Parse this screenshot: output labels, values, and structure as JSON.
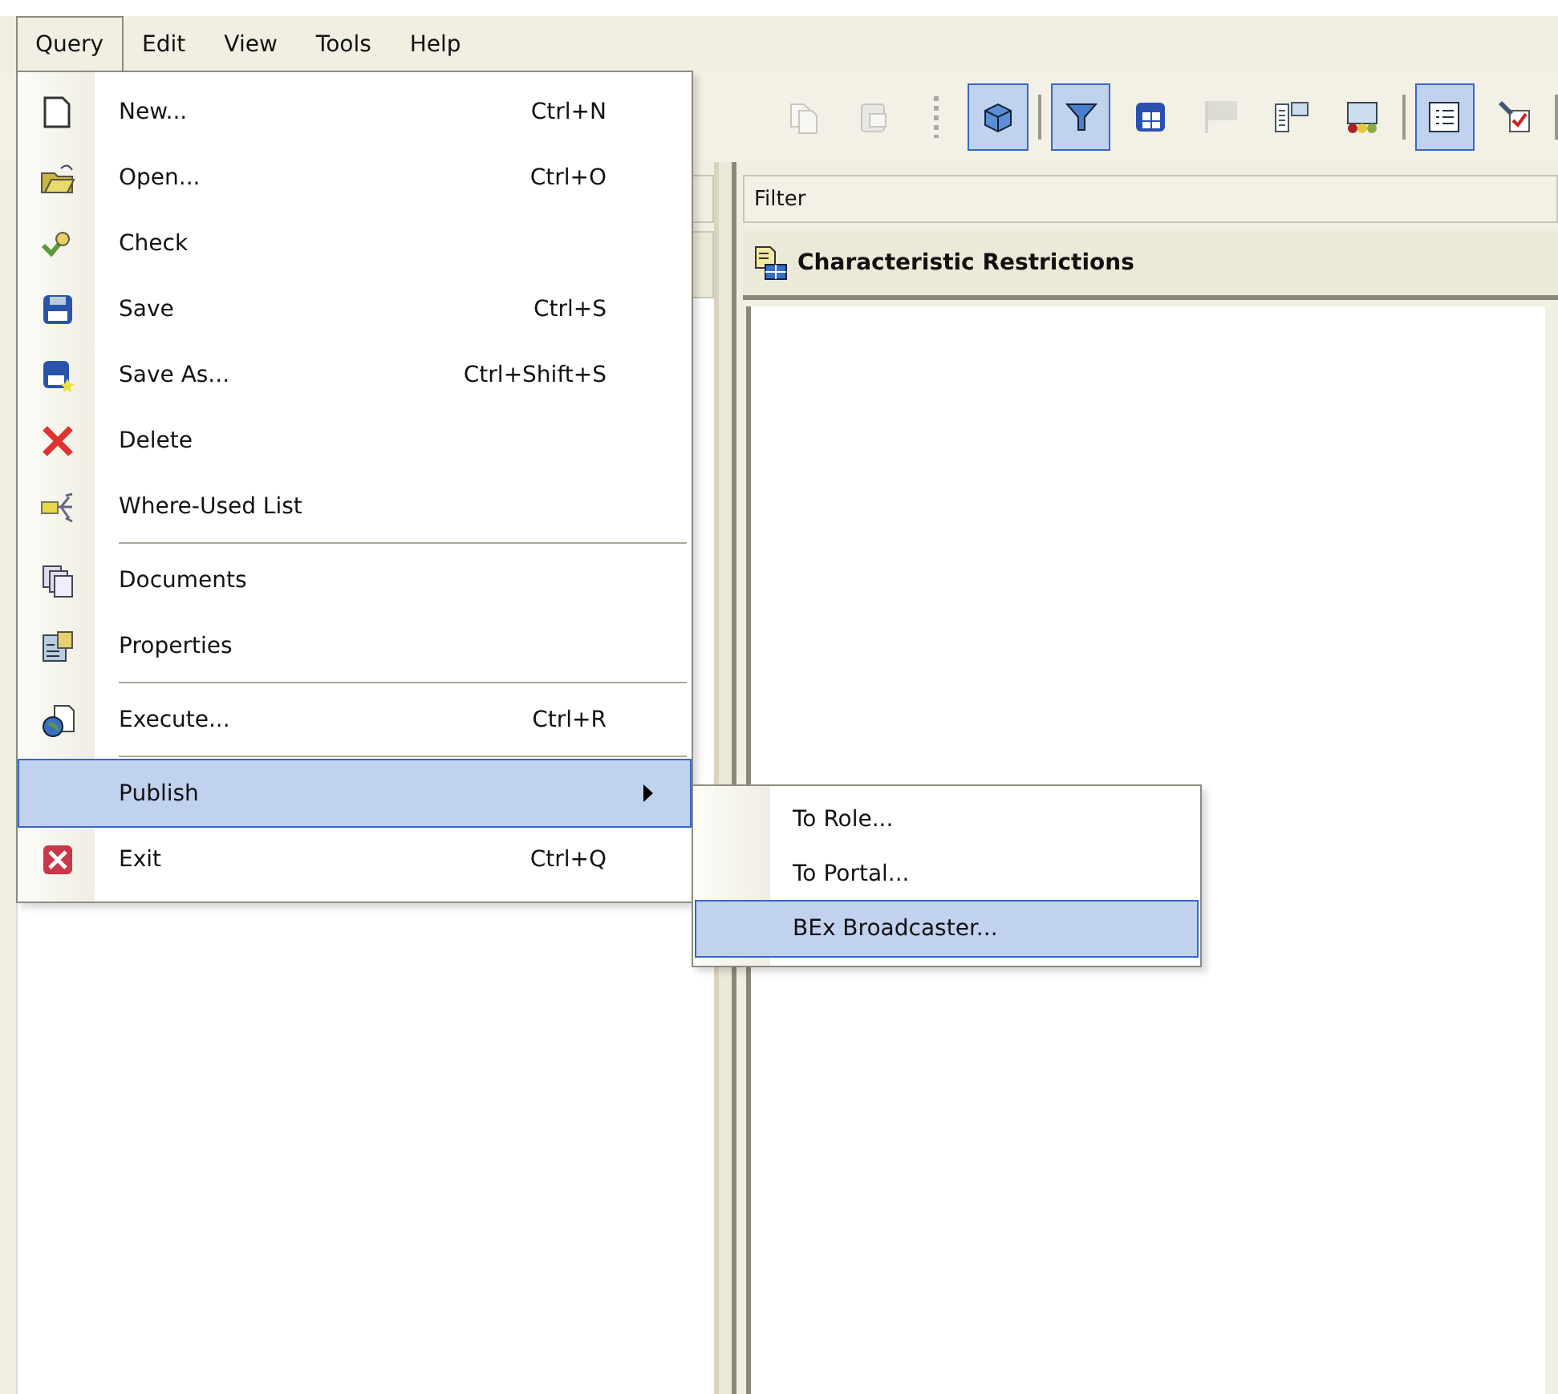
{
  "menubar": [
    {
      "label": "Query",
      "selected": true
    },
    {
      "label": "Edit",
      "selected": false
    },
    {
      "label": "View",
      "selected": false
    },
    {
      "label": "Tools",
      "selected": false
    },
    {
      "label": "Help",
      "selected": false
    }
  ],
  "toolbar": [
    {
      "kind": "copy",
      "pressed": false,
      "disabled": true
    },
    {
      "kind": "paste",
      "pressed": false,
      "disabled": true
    },
    {
      "kind": "grip"
    },
    {
      "kind": "cube",
      "pressed": true,
      "disabled": false
    },
    {
      "kind": "separator"
    },
    {
      "kind": "filter",
      "pressed": true,
      "disabled": false
    },
    {
      "kind": "grid",
      "pressed": false,
      "disabled": false
    },
    {
      "kind": "flag",
      "pressed": false,
      "disabled": true
    },
    {
      "kind": "layout",
      "pressed": false,
      "disabled": false
    },
    {
      "kind": "monitor",
      "pressed": false,
      "disabled": false
    },
    {
      "kind": "separator"
    },
    {
      "kind": "list",
      "pressed": true,
      "disabled": false
    },
    {
      "kind": "check",
      "pressed": false,
      "disabled": false
    },
    {
      "kind": "separator"
    }
  ],
  "filter_panel": {
    "title": "Filter",
    "section_title": "Characteristic Restrictions"
  },
  "query_menu": {
    "items": [
      {
        "label": "New...",
        "shortcut": "Ctrl+N",
        "selected": false,
        "divider_after": false,
        "submenu": false
      },
      {
        "label": "Open...",
        "shortcut": "Ctrl+O",
        "selected": false,
        "divider_after": false,
        "submenu": false
      },
      {
        "label": "Check",
        "selected": false,
        "divider_after": false,
        "submenu": false
      },
      {
        "label": "Save",
        "shortcut": "Ctrl+S",
        "selected": false,
        "divider_after": false,
        "submenu": false
      },
      {
        "label": "Save As...",
        "shortcut": "Ctrl+Shift+S",
        "selected": false,
        "divider_after": false,
        "submenu": false
      },
      {
        "label": "Delete",
        "selected": false,
        "divider_after": false,
        "submenu": false
      },
      {
        "label": "Where-Used List",
        "selected": false,
        "divider_after": true,
        "submenu": false
      },
      {
        "label": "Documents",
        "selected": false,
        "divider_after": false,
        "submenu": false
      },
      {
        "label": "Properties",
        "selected": false,
        "divider_after": true,
        "submenu": false
      },
      {
        "label": "Execute...",
        "shortcut": "Ctrl+R",
        "selected": false,
        "divider_after": true,
        "submenu": false
      },
      {
        "label": "Publish",
        "selected": true,
        "divider_after": false,
        "submenu": true
      },
      {
        "label": "Exit",
        "shortcut": "Ctrl+Q",
        "selected": false,
        "divider_after": false,
        "submenu": false
      }
    ]
  },
  "publish_submenu": {
    "items": [
      {
        "label": "To Role...",
        "selected": false
      },
      {
        "label": "To Portal...",
        "selected": false
      },
      {
        "label": "BEx Broadcaster...",
        "selected": true
      }
    ]
  }
}
